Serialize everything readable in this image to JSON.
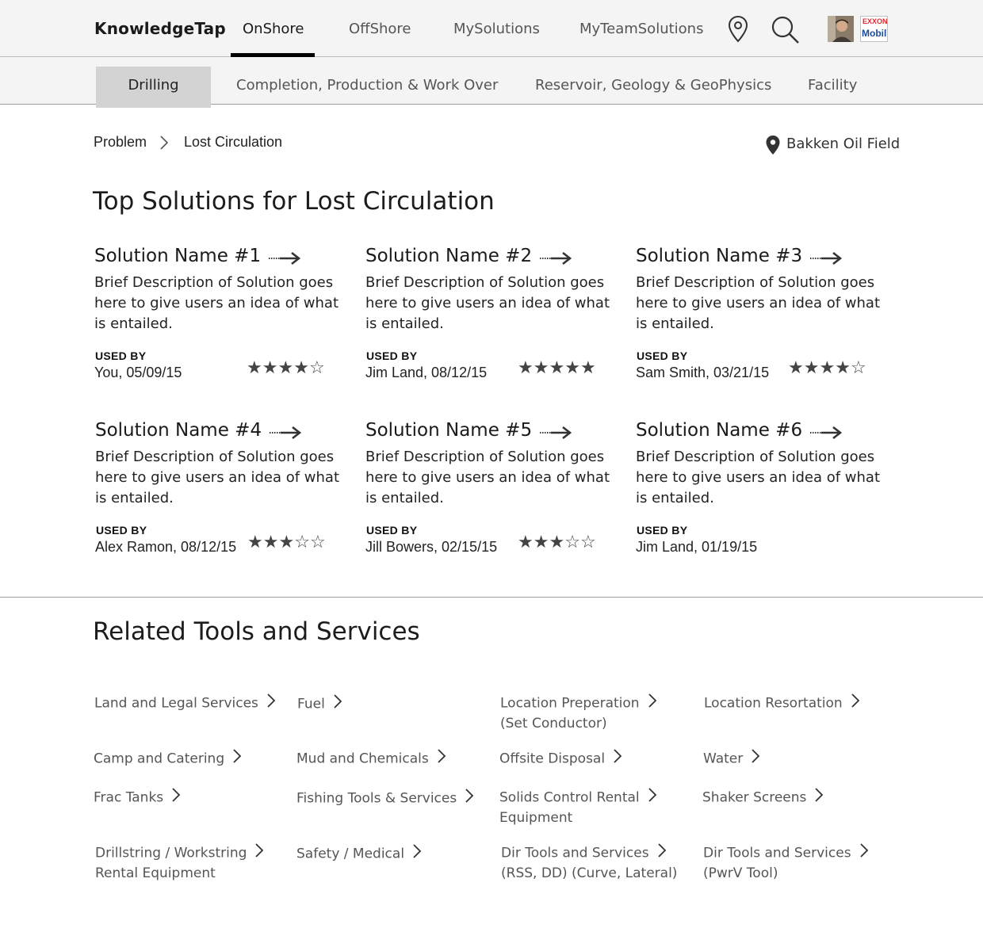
{
  "brand": "KnowledgeTap",
  "top_tabs": [
    "OnShore",
    "OffShore",
    "MySolutions",
    "MyTeamSolutions"
  ],
  "top_icons": [
    "location-pin-icon",
    "search-icon",
    "user-avatar",
    "exxon-mobil-logo"
  ],
  "logo": {
    "line1": "EXXON",
    "line2": "Mobil"
  },
  "sub_tabs": [
    "Drilling",
    "Completion, Production & Work Over",
    "Reservoir, Geology & GeoPhysics",
    "Facility"
  ],
  "breadcrumb": [
    "Problem",
    "Lost Circulation"
  ],
  "location": "Bakken Oil Field",
  "solutions_heading": "Top Solutions for Lost Circulation",
  "used_by_label": "USED BY",
  "solutions": [
    {
      "name": "Solution Name #1",
      "desc": "Brief Description of Solution goes here to give users an idea of what is entailed.",
      "user": "You, 05/09/15",
      "rating": 4
    },
    {
      "name": "Solution Name #2",
      "desc": "Brief Description of Solution goes here to give users an idea of what is entailed.",
      "user": "Jim Land, 08/12/15",
      "rating": 5
    },
    {
      "name": "Solution Name #3",
      "desc": "Brief Description of Solution goes here to give users an idea of what is entailed.",
      "user": "Sam Smith, 03/21/15",
      "rating": 4
    },
    {
      "name": "Solution Name #4",
      "desc": "Brief Description of Solution goes here to give users an idea of what is entailed.",
      "user": "Alex Ramon, 08/12/15",
      "rating": 3
    },
    {
      "name": "Solution Name #5",
      "desc": "Brief Description of Solution goes here to give users an idea of what is entailed.",
      "user": "Jill Bowers, 02/15/15",
      "rating": 3
    },
    {
      "name": "Solution Name #6",
      "desc": "Brief Description of Solution goes here to give users an idea of what is entailed.",
      "user": "Jim Land, 01/19/15",
      "rating": null
    }
  ],
  "related_heading": "Related Tools and Services",
  "tools": [
    {
      "line1": "Land and Legal Services",
      "line2": ""
    },
    {
      "line1": "Fuel",
      "line2": ""
    },
    {
      "line1": "Location Preperation",
      "line2": "(Set Conductor)"
    },
    {
      "line1": "Location Resortation",
      "line2": ""
    },
    {
      "line1": "Camp and Catering",
      "line2": ""
    },
    {
      "line1": "Mud and Chemicals",
      "line2": ""
    },
    {
      "line1": "Offsite Disposal",
      "line2": ""
    },
    {
      "line1": "Water",
      "line2": ""
    },
    {
      "line1": "Frac Tanks",
      "line2": ""
    },
    {
      "line1": "Fishing Tools & Services",
      "line2": ""
    },
    {
      "line1": "Solids Control Rental",
      "line2": "Equipment"
    },
    {
      "line1": "Shaker Screens",
      "line2": ""
    },
    {
      "line1": "Drillstring / Workstring",
      "line2": "Rental Equipment"
    },
    {
      "line1": "Safety / Medical",
      "line2": ""
    },
    {
      "line1": "Dir Tools and Services",
      "line2": "(RSS, DD) (Curve, Lateral)"
    },
    {
      "line1": "Dir Tools and Services",
      "line2": "(PwrV Tool)"
    }
  ]
}
